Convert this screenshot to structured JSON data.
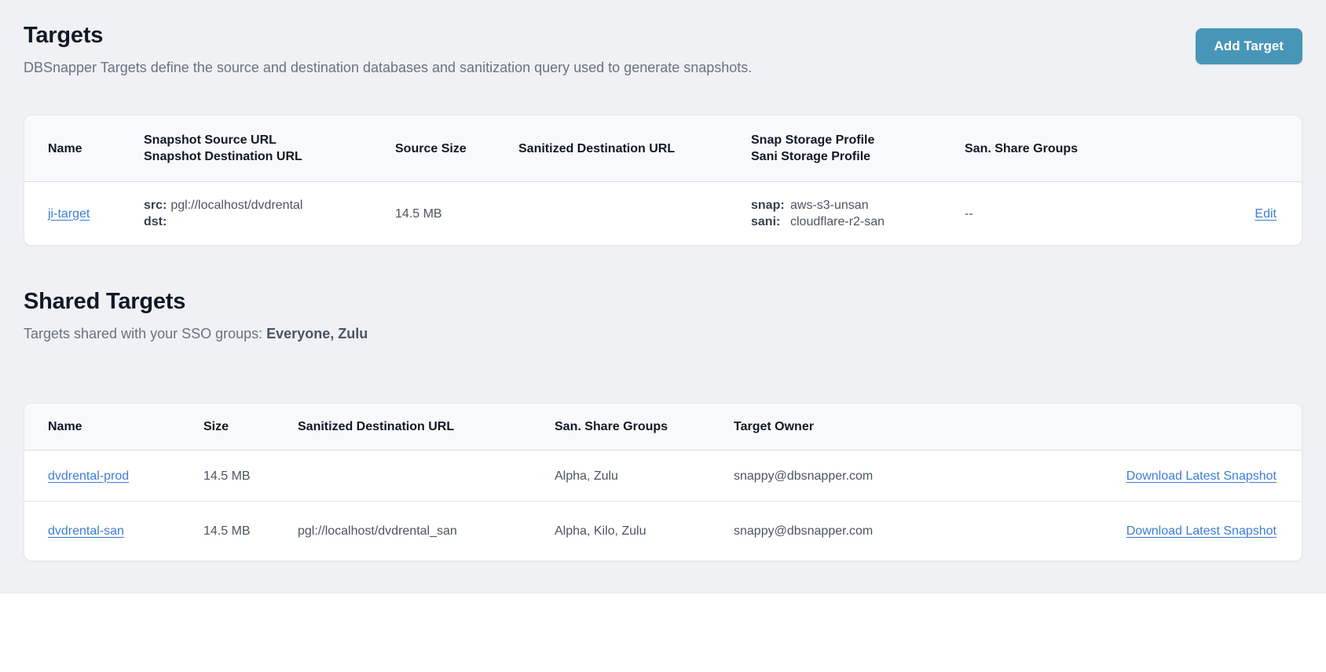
{
  "colors": {
    "page_bg": "#eff1f4",
    "accent": "#4796b8",
    "link": "#3d7dd6"
  },
  "targets": {
    "title": "Targets",
    "description": "DBSnapper Targets define the source and destination databases and sanitization query used to generate snapshots.",
    "add_button": "Add Target",
    "table": {
      "headers": {
        "name": "Name",
        "source_url_line1": "Snapshot Source URL",
        "source_url_line2": "Snapshot Destination URL",
        "source_size": "Source Size",
        "sanitized_destination_url": "Sanitized Destination URL",
        "storage_line1": "Snap Storage Profile",
        "storage_line2": "Sani Storage Profile",
        "share_groups": "San. Share Groups",
        "actions": ""
      },
      "rows": [
        {
          "name": "ji-target",
          "src_label": "src:",
          "src_value": "pgl://localhost/dvdrental",
          "dst_label": "dst:",
          "dst_value": "",
          "source_size": "14.5 MB",
          "sanitized_destination_url": "",
          "snap_label": "snap:",
          "snap_value": "aws-s3-unsan",
          "sani_label": "sani:",
          "sani_value": "cloudflare-r2-san",
          "share_groups": "--",
          "action": "Edit"
        }
      ]
    }
  },
  "shared_targets": {
    "title": "Shared Targets",
    "description_prefix": "Targets shared with your SSO groups: ",
    "description_groups": "Everyone, Zulu",
    "table": {
      "headers": {
        "name": "Name",
        "size": "Size",
        "sanitized_destination_url": "Sanitized Destination URL",
        "share_groups": "San. Share Groups",
        "target_owner": "Target Owner",
        "actions": ""
      },
      "rows": [
        {
          "name": "dvdrental-prod",
          "size": "14.5 MB",
          "sanitized_destination_url": "",
          "share_groups": "Alpha, Zulu",
          "target_owner": "snappy@dbsnapper.com",
          "action": "Download Latest Snapshot"
        },
        {
          "name": "dvdrental-san",
          "size": "14.5 MB",
          "sanitized_destination_url": "pgl://localhost/dvdrental_san",
          "share_groups": "Alpha, Kilo, Zulu",
          "target_owner": "snappy@dbsnapper.com",
          "action": "Download Latest Snapshot"
        }
      ]
    }
  }
}
